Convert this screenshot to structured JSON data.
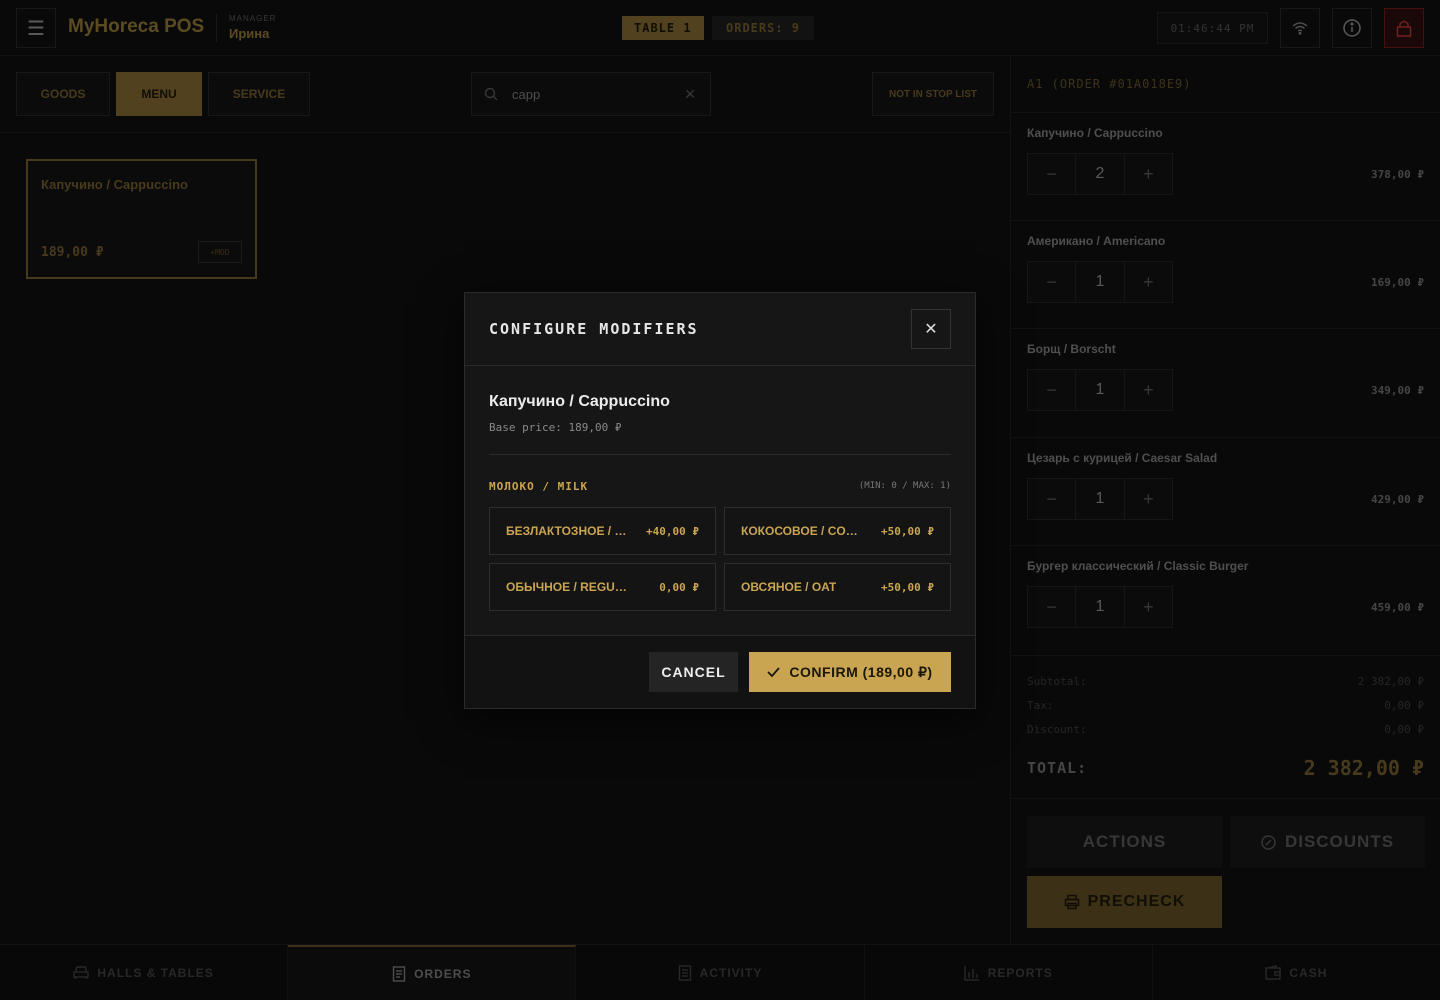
{
  "app": {
    "title": "MyHoreca POS",
    "role": "MANAGER",
    "user": "Ирина"
  },
  "header": {
    "table": "TABLE 1",
    "orders": "ORDERS: 9",
    "clock": "01:46:44 PM"
  },
  "categories": [
    {
      "label": "GOODS"
    },
    {
      "label": "MENU",
      "active": true
    },
    {
      "label": "SERVICE"
    }
  ],
  "search": {
    "value": "capp",
    "placeholder": ""
  },
  "stop_list": {
    "label": "NOT IN STOP LIST"
  },
  "products": [
    {
      "name": "Капучино / Cappuccino",
      "price": "189,00 ₽",
      "tag": "+MOD"
    }
  ],
  "order": {
    "title": "A1 (ORDER #01A018E9)",
    "lines": [
      {
        "name": "Капучино / Cappuccino",
        "qty": "2",
        "price": "378,00 ₽"
      },
      {
        "name": "Американо / Americano",
        "qty": "1",
        "price": "169,00 ₽"
      },
      {
        "name": "Борщ / Borscht",
        "qty": "1",
        "price": "349,00 ₽"
      },
      {
        "name": "Цезарь с курицей / Caesar Salad",
        "qty": "1",
        "price": "429,00 ₽"
      },
      {
        "name": "Бургер классический / Classic Burger",
        "qty": "1",
        "price": "459,00 ₽"
      }
    ],
    "subtotal_label": "Subtotal:",
    "subtotal": "2 382,00 ₽",
    "tax_label": "Tax:",
    "tax": "0,00 ₽",
    "discount_label": "Discount:",
    "discount": "0,00 ₽",
    "total_label": "TOTAL:",
    "total": "2 382,00 ₽",
    "actions_label": "ACTIONS",
    "discounts_label": "DISCOUNTS",
    "precheck_label": "PRECHECK"
  },
  "bottom_nav": [
    {
      "label": "HALLS & TABLES",
      "icon": "sofa-icon"
    },
    {
      "label": "ORDERS",
      "icon": "receipt-icon",
      "active": true
    },
    {
      "label": "ACTIVITY",
      "icon": "list-icon"
    },
    {
      "label": "REPORTS",
      "icon": "bar-chart-icon"
    },
    {
      "label": "CASH",
      "icon": "wallet-icon"
    }
  ],
  "modal": {
    "title": "CONFIGURE MODIFIERS",
    "product": "Капучино / Cappuccino",
    "base_price": "Base price: 189,00 ₽",
    "group_name": "МОЛОКО / MILK",
    "group_limits": "(MIN: 0 / MAX: 1)",
    "options": [
      {
        "name": "БЕЗЛАКТОЗНОЕ / LACTOSE-FREE",
        "price": "+40,00 ₽"
      },
      {
        "name": "КОКОСОВОЕ / COCONUT",
        "price": "+50,00 ₽"
      },
      {
        "name": "ОБЫЧНОЕ / REGULAR",
        "price": "0,00 ₽"
      },
      {
        "name": "ОВСЯНОЕ / OAT",
        "price": "+50,00 ₽"
      }
    ],
    "cancel_label": "CANCEL",
    "confirm_label": "CONFIRM (189,00 ₽)"
  },
  "colors": {
    "accent": "#c9a552",
    "accent_dim": "#7d6530",
    "background": "#0e0e0e",
    "danger": "#a33333"
  }
}
